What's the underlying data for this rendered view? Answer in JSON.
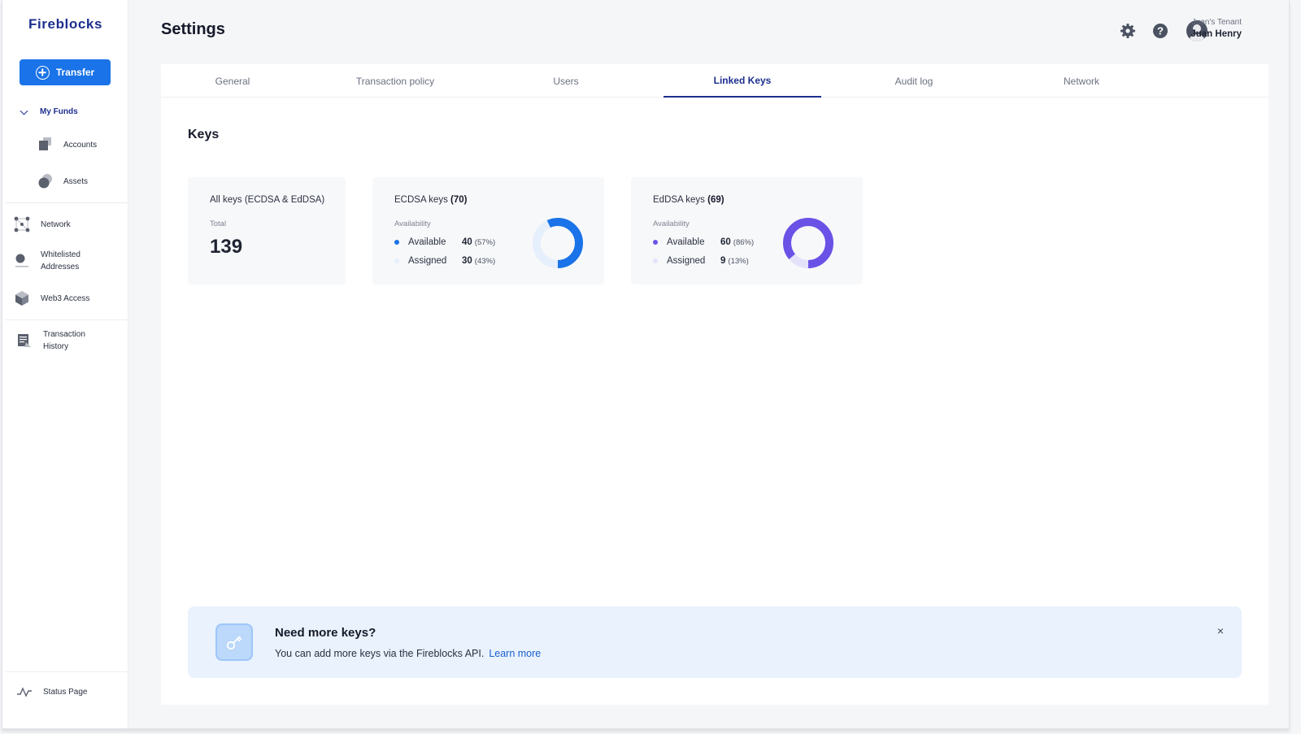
{
  "app": {
    "logo": "Fireblocks",
    "page_title": "Settings"
  },
  "sidebar": {
    "transfer_label": "Transfer",
    "my_funds_label": "My Funds",
    "items": [
      {
        "label": "Accounts",
        "icon": "accounts-icon"
      },
      {
        "label": "Assets",
        "icon": "assets-icon"
      },
      {
        "label": "Network",
        "icon": "network-icon"
      },
      {
        "label_line1": "Whitelisted",
        "label_line2": "Addresses",
        "icon": "whitelist-icon"
      },
      {
        "label": "Web3 Access",
        "icon": "cube-icon"
      },
      {
        "label_line1": "Transaction",
        "label_line2": "History",
        "icon": "history-icon"
      }
    ],
    "status_page_label": "Status Page"
  },
  "header": {
    "tenant": "Juan's Tenant",
    "user_name": "Juan Henry"
  },
  "tabs": [
    {
      "label": "General",
      "active": false
    },
    {
      "label": "Transaction policy",
      "active": false
    },
    {
      "label": "Users",
      "active": false
    },
    {
      "label": "Linked Keys",
      "active": true
    },
    {
      "label": "Audit log",
      "active": false
    },
    {
      "label": "Network",
      "active": false
    }
  ],
  "keys": {
    "section_title": "Keys",
    "all": {
      "title": "All keys (ECDSA & EdDSA)",
      "total_label": "Total",
      "total": "139"
    },
    "ecdsa": {
      "title": "ECDSA keys",
      "count": "(70)",
      "availability_label": "Availability",
      "available_label": "Available",
      "available_value": "40",
      "available_pct": "(57%)",
      "assigned_label": "Assigned",
      "assigned_value": "30",
      "assigned_pct": "(43%)",
      "available_fraction": 0.57,
      "color": "#1a73e8",
      "track_color": "#e6effc"
    },
    "eddsa": {
      "title": "EdDSA keys",
      "count": "(69)",
      "availability_label": "Availability",
      "available_label": "Available",
      "available_value": "60",
      "available_pct": "(86%)",
      "assigned_label": "Assigned",
      "assigned_value": "9",
      "assigned_pct": "(13%)",
      "available_fraction": 0.86,
      "color": "#6b52e6",
      "track_color": "#e4e2fb"
    }
  },
  "banner": {
    "title": "Need more keys?",
    "text": "You can add more keys via the Fireblocks API.",
    "link": "Learn more",
    "close": "×"
  }
}
